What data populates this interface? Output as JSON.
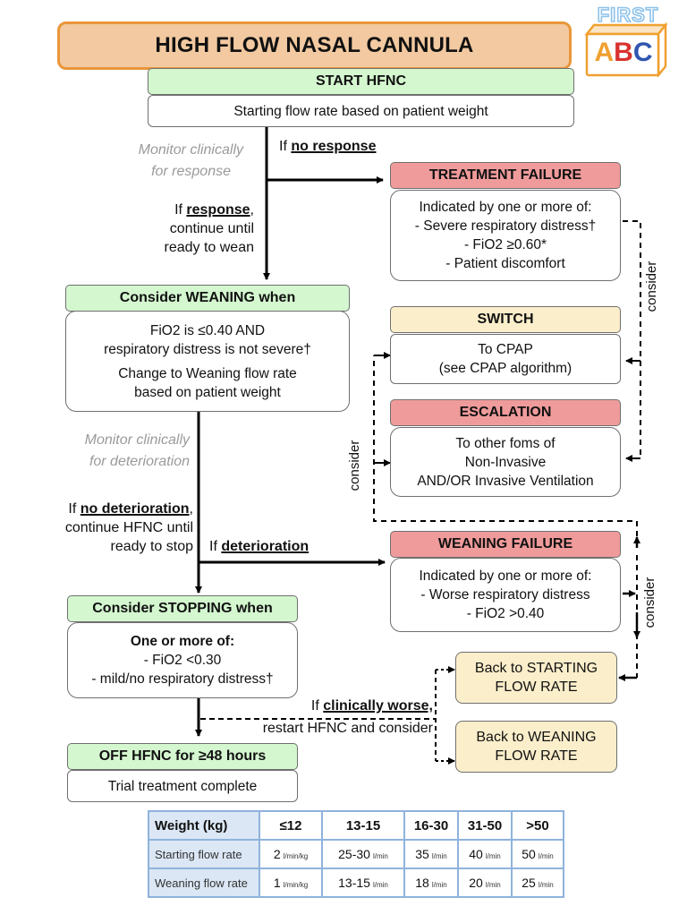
{
  "title": "HIGH FLOW NASAL CANNULA",
  "logo": {
    "top_text": "FIRST",
    "letters": [
      "A",
      "B",
      "C"
    ],
    "colors": {
      "A": "#f0a030",
      "B": "#d8322e",
      "C": "#2f56b0",
      "frame": "#f0a030",
      "top": "#8fc3ea"
    }
  },
  "colors": {
    "title_bg": "#f2c9a0",
    "title_border": "#e9963a",
    "green": "#d4f7cf",
    "red": "#f09b9b",
    "yellow": "#fbeecb",
    "table_border": "#8fb3dc",
    "table_head_bg": "#dbe7f5",
    "grey_text": "#9a9a9a"
  },
  "start": {
    "header": "START HFNC",
    "body": "Starting flow rate based on patient weight"
  },
  "monitor_response": [
    "Monitor clinically",
    "for response"
  ],
  "no_response_label": {
    "prefix": "If ",
    "emph": "no response"
  },
  "response_label": {
    "prefix": "If ",
    "emph": "response",
    "suffix": ",",
    "lines": [
      "continue until",
      "ready to wean"
    ]
  },
  "treatment_failure": {
    "header": "TREATMENT FAILURE",
    "lines": [
      "Indicated by one or more of:",
      "- Severe respiratory distress†",
      "- FiO2 ≥0.60*",
      "- Patient discomfort"
    ]
  },
  "weaning": {
    "header": "Consider WEANING when",
    "lines1": [
      "FiO2 is ≤0.40 AND",
      "respiratory distress is not severe†"
    ],
    "lines2": [
      "Change to Weaning flow rate",
      "based on patient weight"
    ]
  },
  "switch": {
    "header": "SWITCH",
    "lines": [
      "To CPAP",
      "(see CPAP algorithm)"
    ]
  },
  "escalation": {
    "header": "ESCALATION",
    "lines": [
      "To other foms of",
      "Non-Invasive",
      "AND/OR Invasive Ventilation"
    ]
  },
  "consider_label": "consider",
  "monitor_deterioration": [
    "Monitor clinically",
    "for deterioration"
  ],
  "no_deterioration_label": {
    "prefix": "If ",
    "emph": "no deterioration",
    "suffix": ",",
    "lines": [
      "continue HFNC until",
      "ready to stop"
    ]
  },
  "deterioration_label": {
    "prefix": "If ",
    "emph": "deterioration"
  },
  "weaning_failure": {
    "header": "WEANING FAILURE",
    "lines": [
      "Indicated by one or more of:",
      "- Worse respiratory distress",
      "- FiO2 >0.40"
    ]
  },
  "stopping": {
    "header": "Consider STOPPING when",
    "bold_line": "One or more of:",
    "lines": [
      "- FiO2 <0.30",
      "- mild/no respiratory distress†"
    ]
  },
  "back_starting": [
    "Back to STARTING",
    "FLOW RATE"
  ],
  "back_weaning": [
    "Back to WEANING",
    "FLOW RATE"
  ],
  "clinically_worse_label": {
    "prefix": "If ",
    "emph": "clinically worse,",
    "line2": "restart HFNC and consider"
  },
  "off": {
    "header": "OFF HFNC for ≥48 hours",
    "body": "Trial treatment complete"
  },
  "table": {
    "header": [
      "Weight (kg)",
      "≤12",
      "13-15",
      "16-30",
      "31-50",
      ">50"
    ],
    "rows": [
      {
        "label": "Starting flow rate",
        "cells": [
          {
            "v": "2",
            "u": "l/min/kg"
          },
          {
            "v": "25-30",
            "u": "l/min"
          },
          {
            "v": "35",
            "u": "l/min"
          },
          {
            "v": "40",
            "u": "l/min"
          },
          {
            "v": "50",
            "u": "l/min"
          }
        ]
      },
      {
        "label": "Weaning flow rate",
        "cells": [
          {
            "v": "1",
            "u": "l/min/kg"
          },
          {
            "v": "13-15",
            "u": "l/min"
          },
          {
            "v": "18",
            "u": "l/min"
          },
          {
            "v": "20",
            "u": "l/min"
          },
          {
            "v": "25",
            "u": "l/min"
          }
        ]
      }
    ]
  }
}
